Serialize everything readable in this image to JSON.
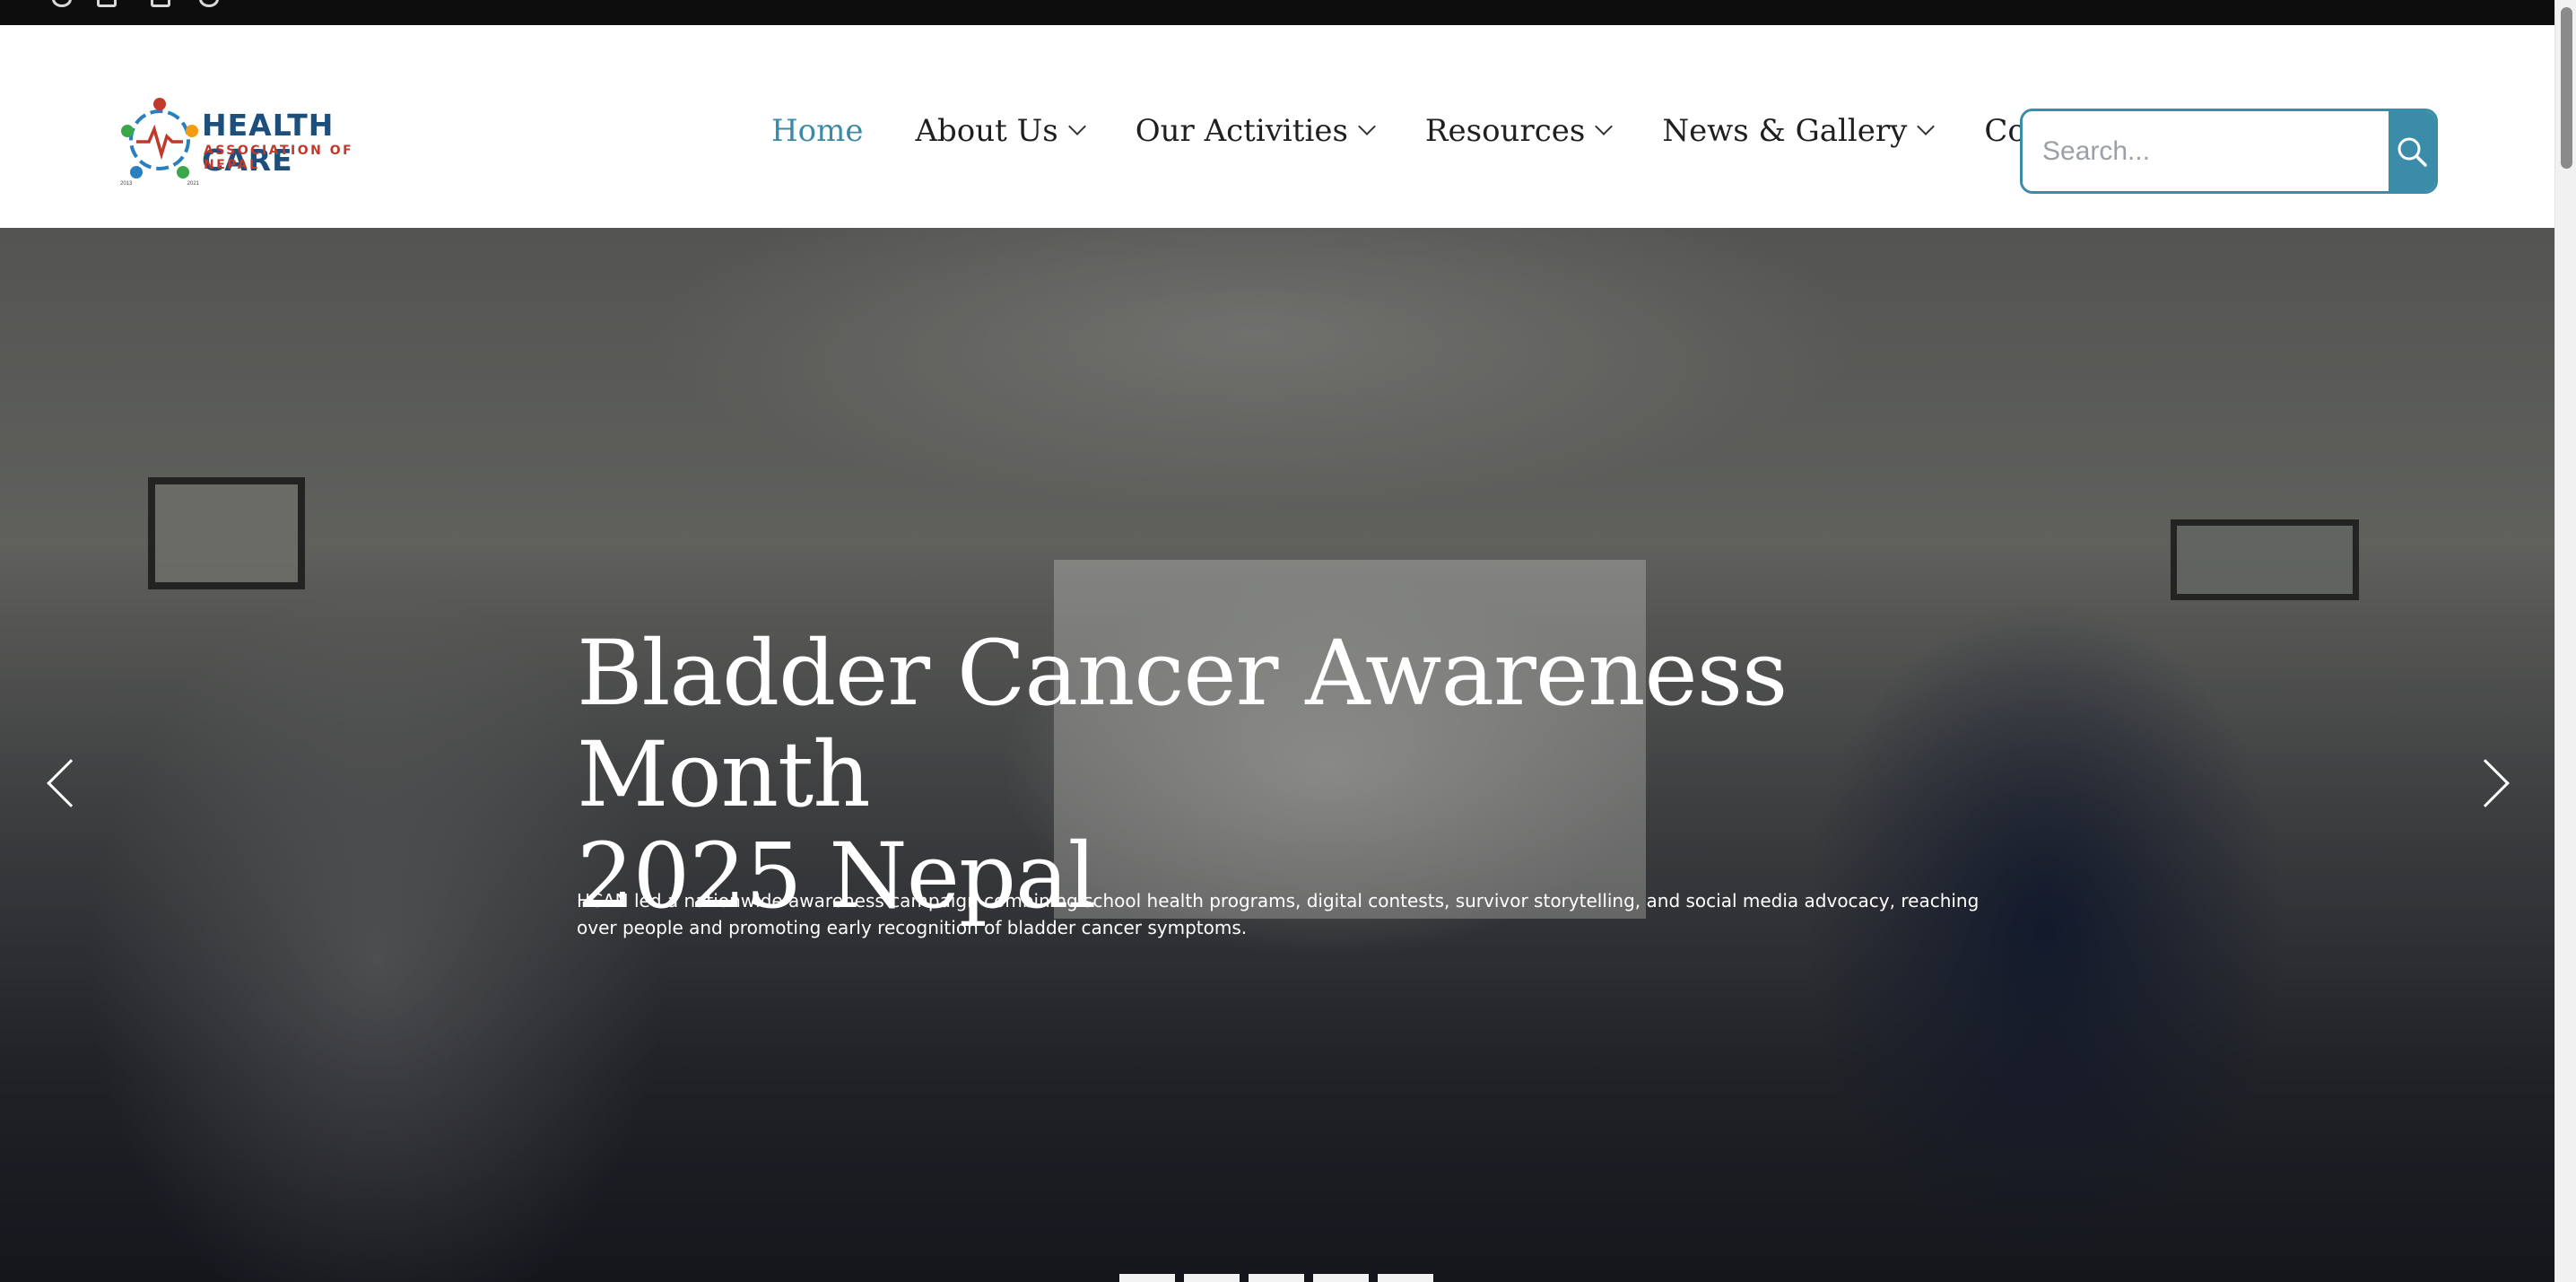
{
  "logo": {
    "name_line1": "HEALTH CARE",
    "name_line2": "ASSOCIATION OF NEPAL",
    "year_left": "2013",
    "year_right": "2021",
    "colors": {
      "red": "#c0392b",
      "blue": "#2a7fbf",
      "green": "#3aa84a",
      "orange": "#f39c12",
      "navy": "#1d4f7c"
    }
  },
  "nav": {
    "items": [
      {
        "label": "Home",
        "active": true,
        "has_dropdown": false
      },
      {
        "label": "About Us",
        "active": false,
        "has_dropdown": true
      },
      {
        "label": "Our Activities",
        "active": false,
        "has_dropdown": true
      },
      {
        "label": "Resources",
        "active": false,
        "has_dropdown": true
      },
      {
        "label": "News & Gallery",
        "active": false,
        "has_dropdown": true
      },
      {
        "label": "Contact",
        "active": false,
        "has_dropdown": false
      }
    ],
    "active_color": "#3b8aa6"
  },
  "search": {
    "placeholder": "Search...",
    "value": "",
    "button_icon": "search-icon",
    "accent": "#3a8ca8"
  },
  "hero": {
    "title_line1": "Bladder Cancer Awareness Month",
    "title_line2": "2025 Nepal",
    "description": "HCAN led a nationwide awareness campaign combining school health programs, digital contests, survivor storytelling, and social media advocacy, reaching over people and promoting early recognition of bladder cancer symptoms.",
    "prev_icon": "chevron-left-icon",
    "next_icon": "chevron-right-icon",
    "slide_count": 5
  }
}
